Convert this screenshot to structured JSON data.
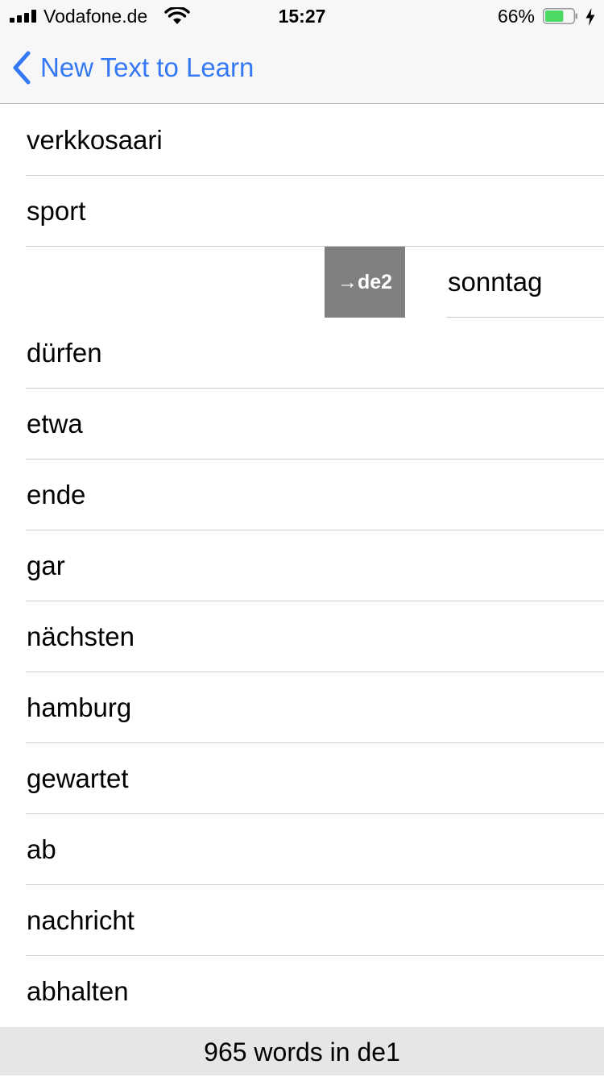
{
  "status_bar": {
    "carrier": "Vodafone.de",
    "time": "15:27",
    "battery_percent": "66%",
    "battery_level": 0.66,
    "battery_color": "#4cd964",
    "icons": [
      "signal-icon",
      "wifi-icon",
      "battery-icon",
      "charging-bolt-icon"
    ]
  },
  "nav": {
    "back_label": "New Text to Learn",
    "back_icon": "chevron-left-icon",
    "accent_color": "#3478f6"
  },
  "words": [
    {
      "text": "verkkosaari"
    },
    {
      "text": "sport"
    },
    {
      "text": "sonntag",
      "swipe_action": "→de2"
    },
    {
      "text": "dürfen"
    },
    {
      "text": "etwa"
    },
    {
      "text": "ende"
    },
    {
      "text": "gar"
    },
    {
      "text": "nächsten"
    },
    {
      "text": "hamburg"
    },
    {
      "text": "gewartet"
    },
    {
      "text": "ab"
    },
    {
      "text": "nachricht"
    },
    {
      "text": "abhalten"
    }
  ],
  "footer": {
    "text": "965 words in de1"
  }
}
